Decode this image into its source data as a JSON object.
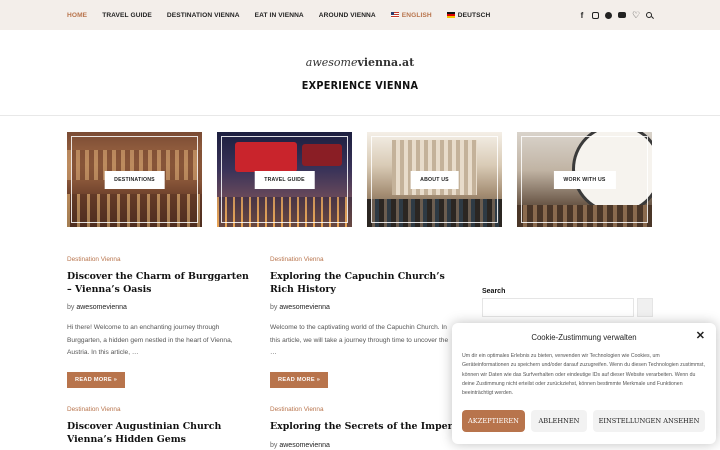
{
  "nav": {
    "items": [
      "HOME",
      "TRAVEL GUIDE",
      "DESTINATION VIENNA",
      "EAT IN VIENNA",
      "AROUND VIENNA"
    ],
    "lang_en": "ENGLISH",
    "lang_de": "DEUTSCH"
  },
  "header": {
    "logo_light": "awesome",
    "logo_bold": "vienna.at",
    "tagline": "EXPERIENCE VIENNA"
  },
  "tiles": [
    "DESTINATIONS",
    "TRAVEL GUIDE",
    "ABOUT US",
    "WORK WITH US"
  ],
  "posts": [
    {
      "category": "Destination Vienna",
      "title": "Discover the Charm of Burggarten – Vienna’s Oasis",
      "by": "by",
      "author": "awesomevienna",
      "excerpt": "Hi there! Welcome to an enchanting journey through Burggarten, a hidden gem nestled in the heart of Vienna, Austria. In this article, …",
      "more": "READ MORE »"
    },
    {
      "category": "Destination Vienna",
      "title": "Exploring the Capuchin Church’s Rich History",
      "by": "by",
      "author": "awesomevienna",
      "excerpt": "Welcome to the captivating world of the Capuchin Church. In this article, we will take a journey through time to uncover the …",
      "more": "READ MORE »"
    },
    {
      "category": "Destination Vienna",
      "title": "Discover Augustinian Church Vienna’s Hidden Gems"
    },
    {
      "category": "Destination Vienna",
      "title": "Exploring the Secrets of the Imperial Crypt",
      "by": "by",
      "author": "awesomevienna"
    }
  ],
  "sidebar": {
    "search_title": "Search"
  },
  "cookie": {
    "title": "Cookie-Zustimmung verwalten",
    "close": "✕",
    "text": "Um dir ein optimales Erlebnis zu bieten, verwenden wir Technologien wie Cookies, um Geräteinformationen zu speichern und/oder darauf zuzugreifen. Wenn du diesen Technologien zustimmst, können wir Daten wie das Surfverhalten oder eindeutige IDs auf dieser Website verarbeiten. Wenn du deine Zustimmung nicht erteilst oder zurückziehst, können bestimmte Merkmale und Funktionen beeinträchtigt werden.",
    "accept": "AKZEPTIEREN",
    "deny": "ABLEHNEN",
    "settings": "EINSTELLUNGEN ANSEHEN"
  },
  "icons": [
    "facebook-icon",
    "instagram-icon",
    "pinterest-icon",
    "youtube-icon",
    "heart-icon",
    "search-icon"
  ],
  "colors": {
    "accent": "#b8744c",
    "topbar": "#f3eeea"
  }
}
